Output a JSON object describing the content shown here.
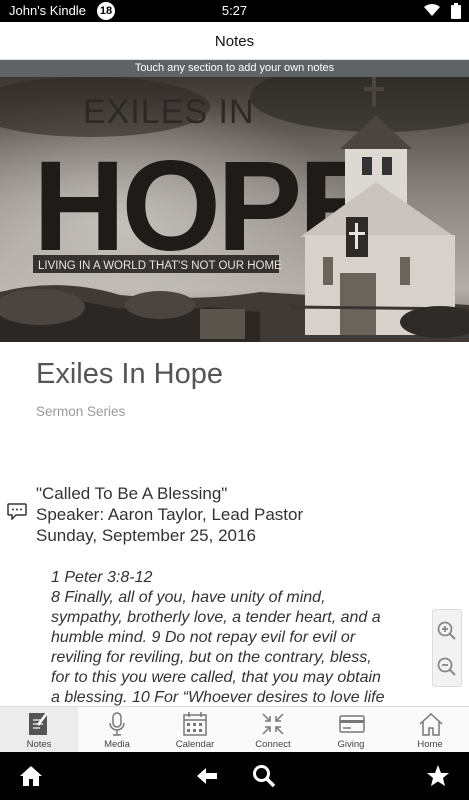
{
  "status_bar": {
    "device_name": "John's Kindle",
    "notification_count": "18",
    "time": "5:27"
  },
  "header": {
    "title": "Notes",
    "hint": "Touch any section to add your own notes"
  },
  "banner": {
    "line1": "EXILES IN",
    "line2": "HOPE",
    "tagline": "LIVING IN A WORLD THAT'S NOT OUR HOME"
  },
  "series": {
    "title": "Exiles In Hope",
    "subtitle": "Sermon Series"
  },
  "sermon": {
    "title": "\"Called To Be A Blessing\"",
    "speaker": "Speaker: Aaron Taylor, Lead Pastor",
    "date": "Sunday, September 25, 2016"
  },
  "scripture": {
    "lines": [
      "1 Peter 3:8-12",
      "8 Finally, all of you, have unity of mind,",
      "sympathy, brotherly love, a tender heart, and a",
      "humble mind. 9 Do not repay evil for evil or",
      "reviling for reviling, but on the contrary, bless,",
      "for to this you were called, that you may obtain",
      "a blessing. 10 For “Whoever desires to love life"
    ]
  },
  "tabs": [
    {
      "label": "Notes",
      "icon": "notes-icon"
    },
    {
      "label": "Media",
      "icon": "microphone-icon"
    },
    {
      "label": "Calendar",
      "icon": "calendar-icon"
    },
    {
      "label": "Connect",
      "icon": "connect-icon"
    },
    {
      "label": "Giving",
      "icon": "credit-card-icon"
    },
    {
      "label": "Home",
      "icon": "home-icon"
    }
  ],
  "nav": [
    "home-icon",
    "back-icon",
    "search-icon",
    "favorites-icon"
  ],
  "colors": {
    "hint_bar": "#5f6366",
    "status_bar": "#000000",
    "title_text": "#555555"
  }
}
